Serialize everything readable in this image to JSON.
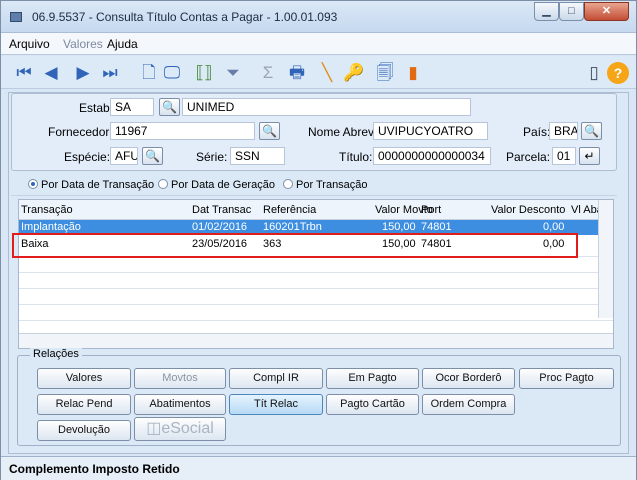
{
  "window": {
    "title": "06.9.5537 - Consulta Título Contas a Pagar - 1.00.01.093"
  },
  "menu": {
    "items": [
      "Arquivo",
      "Valores",
      "Ajuda"
    ]
  },
  "toolbar": {
    "icons": [
      "first",
      "prev",
      "next",
      "last",
      "new-document",
      "view",
      "goto",
      "filter",
      "sum",
      "print",
      "edit",
      "key",
      "report",
      "export",
      "exit",
      "help"
    ]
  },
  "form": {
    "estab_label": "Estab:",
    "estab_value": "SA",
    "estab_name": "UNIMED",
    "fornecedor_label": "Fornecedor:",
    "fornecedor_value": "11967",
    "nome_abrev_label": "Nome Abrev:",
    "nome_abrev_value": "UVIPUCYOATRO",
    "pais_label": "País:",
    "pais_value": "BRA",
    "especie_label": "Espécie:",
    "especie_value": "AFU",
    "serie_label": "Série:",
    "serie_value": "SSN",
    "titulo_label": "Título:",
    "titulo_value": "0000000000000034",
    "parcela_label": "Parcela:",
    "parcela_value": "01"
  },
  "radios": {
    "options": [
      "Por Data de Transação",
      "Por Data de Geração",
      "Por Transação"
    ],
    "selected": "Por Data de Transação"
  },
  "table": {
    "headers": [
      "Transação",
      "Dat Transac",
      "Referência",
      "Valor Movto",
      "Port",
      "Valor Desconto",
      "Vl Aba"
    ],
    "rows": [
      {
        "transacao": "Implantação",
        "dat_transac": "01/02/2016",
        "referencia": "160201Trbn",
        "valor_movto": "150,00",
        "port": "74801",
        "valor_desconto": "0,00"
      },
      {
        "transacao": "Baixa",
        "dat_transac": "23/05/2016",
        "referencia": "363",
        "valor_movto": "150,00",
        "port": "74801",
        "valor_desconto": "0,00"
      }
    ]
  },
  "relacoes": {
    "title": "Relações",
    "buttons": [
      "Valores",
      "Movtos",
      "Compl IR",
      "Em Pagto",
      "Ocor Borderô",
      "Proc Pagto",
      "Relac Pend",
      "Abatimentos",
      "Tít Relac",
      "Pagto Cartão",
      "Ordem Compra",
      "Devolução"
    ],
    "esocial": "eSocial"
  },
  "status": {
    "text": "Complemento Imposto Retido"
  },
  "colors": {
    "selected_row": "#3d8ee0",
    "highlight_box": "#e21b1b"
  }
}
